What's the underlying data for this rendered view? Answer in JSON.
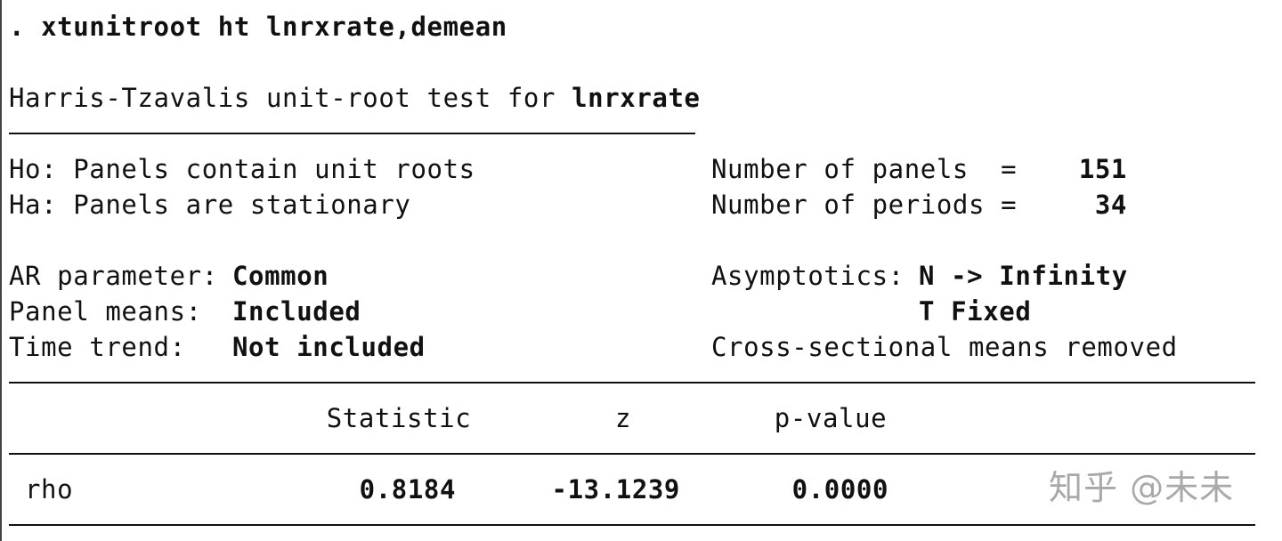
{
  "command": ". xtunitroot ht lnrxrate,demean",
  "title": {
    "prefix": "Harris-Tzavalis unit-root test for ",
    "variable": "lnrxrate"
  },
  "hypotheses": {
    "ho": "Ho: Panels contain unit roots",
    "ha": "Ha: Panels are stationary"
  },
  "panel_info": {
    "panels_label": "Number of panels  =",
    "panels_value": "151",
    "periods_label": "Number of periods =",
    "periods_value": "34"
  },
  "settings": {
    "ar_label": "AR parameter:",
    "ar_value": "Common",
    "means_label": "Panel means:",
    "means_value": "Included",
    "trend_label": "Time trend:",
    "trend_value": "Not included"
  },
  "asymptotics": {
    "label": "Asymptotics:",
    "value1": "N -> Infinity",
    "value2": "T Fixed",
    "note": "Cross-sectional means removed"
  },
  "table": {
    "headers": [
      "Statistic",
      "z",
      "p-value"
    ],
    "rows": [
      {
        "name": "rho",
        "statistic": "0.8184",
        "z": "-13.1239",
        "p": "0.0000"
      }
    ]
  },
  "watermark": "知乎 @未未"
}
